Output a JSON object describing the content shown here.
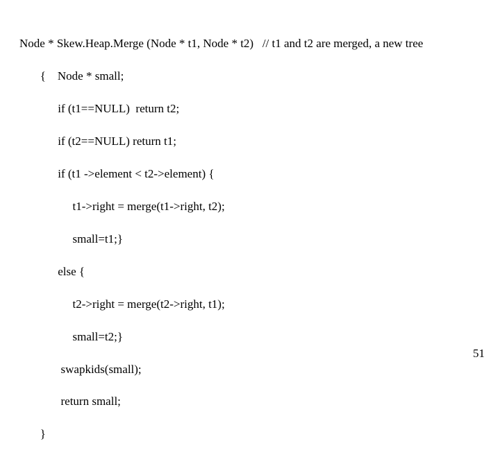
{
  "code": {
    "l1": "Node * Skew.Heap.Merge (Node * t1, Node * t2)   // t1 and t2 are merged, a new tree",
    "l2": "       {    Node * small;",
    "l3": "             if (t1==NULL)  return t2;",
    "l4": "             if (t2==NULL) return t1;",
    "l5": "             if (t1 ->element < t2->element) {",
    "l6": "                  t1->right = merge(t1->right, t2);",
    "l7": "                  small=t1;}",
    "l8": "             else {",
    "l9": "                  t2->right = merge(t2->right, t1);",
    "l10": "                  small=t2;}",
    "l11": "              swapkids(small);",
    "l12": "              return small;",
    "l13": "       }"
  },
  "page_number": "51"
}
